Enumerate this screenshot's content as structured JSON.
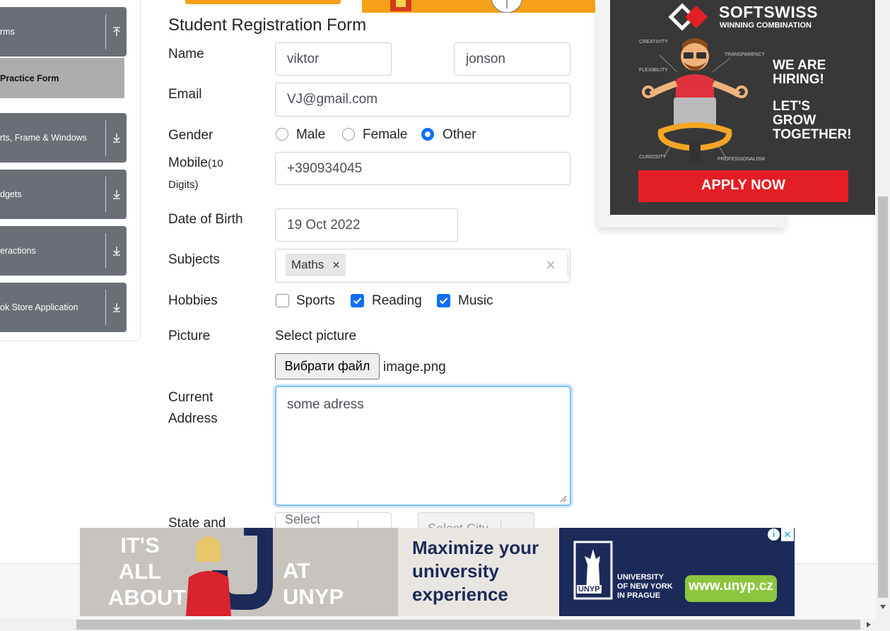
{
  "sidebar": {
    "groups": [
      {
        "label": "rms",
        "icon": "upload-arrow-icon"
      },
      {
        "label": "rts, Frame & Windows",
        "icon": "download-arrow-icon"
      },
      {
        "label": "dgets",
        "icon": "download-arrow-icon"
      },
      {
        "label": "eractions",
        "icon": "download-arrow-icon"
      },
      {
        "label": "ok Store Application",
        "icon": "download-arrow-icon"
      }
    ],
    "active_item": "Practice Form"
  },
  "form": {
    "title": "Student Registration Form",
    "name_label": "Name",
    "first_name": "viktor",
    "last_name": "jonson",
    "email_label": "Email",
    "email": "VJ@gmail.com",
    "gender_label": "Gender",
    "gender_options": [
      "Male",
      "Female",
      "Other"
    ],
    "gender_selected": "Other",
    "mobile_label": "Mobile",
    "mobile_hint": "(10",
    "mobile_hint2": "Digits)",
    "mobile": "+390934045",
    "dob_label": "Date of Birth",
    "dob": "19 Oct 2022",
    "subjects_label": "Subjects",
    "subject_chip": "Maths",
    "chip_remove": "×",
    "subjects_clear": "×",
    "hobbies_label": "Hobbies",
    "hobbies": [
      {
        "label": "Sports",
        "checked": false
      },
      {
        "label": "Reading",
        "checked": true
      },
      {
        "label": "Music",
        "checked": true
      }
    ],
    "picture_label": "Picture",
    "select_picture": "Select picture",
    "file_button": "Вибрати файл",
    "file_name": "image.png",
    "address_label_1": "Current",
    "address_label_2": "Address",
    "address": "some adress",
    "state_city_label": "State and",
    "state_placeholder": "Select",
    "city_placeholder": "Select City"
  },
  "right_ad": {
    "brand": "SOFTSWISS",
    "tagline": "WINNING COMBINATION",
    "hiring": [
      "WE ARE",
      "HIRING!"
    ],
    "together": [
      "LET'S",
      "GROW",
      "TOGETHER!"
    ],
    "traits": [
      "CREATIVITY",
      "TRANSPARENCY",
      "FLEXIBILITY",
      "CURIOSITY",
      "PROFESSIONALISM"
    ],
    "cta": "APPLY NOW"
  },
  "bottom_ad": {
    "left_text": [
      "IT'S",
      "ALL",
      "ABOUT"
    ],
    "at_text": [
      "AT",
      "UNYP"
    ],
    "headline": [
      "Maximize your",
      "university",
      "experience"
    ],
    "logo": "UNYP",
    "university": [
      "UNIVERSITY",
      "OF NEW YORK",
      "IN PRAGUE"
    ],
    "url": "www.unyp.cz",
    "info_icon": "i",
    "close_icon": "✕"
  },
  "colors": {
    "sidebar_group": "#6a6e75",
    "sidebar_active": "#adadad",
    "primary": "#0d6efd",
    "ad_red": "#e31e24",
    "ad_dark": "#383839",
    "unyp_navy": "#1c2a5a",
    "unyp_green": "#8cc63f"
  }
}
